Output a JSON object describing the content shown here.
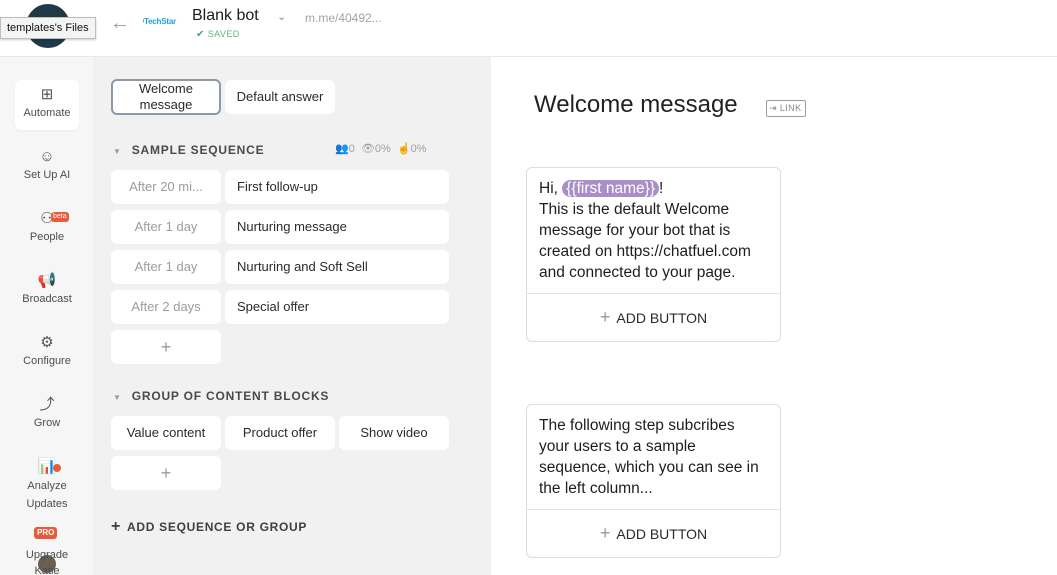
{
  "header": {
    "tooltip": "templates's Files",
    "techstar_logo": "TechStar",
    "bot_name": "Blank bot",
    "saved_status": "SAVED",
    "bot_url": "m.me/40492...",
    "back_icon": "arrow-left-icon"
  },
  "sidebar": {
    "items": [
      {
        "label": "Automate",
        "icon": "automate-icon"
      },
      {
        "label": "Set Up AI",
        "icon": "ai-icon"
      },
      {
        "label": "People",
        "icon": "people-icon",
        "badge": "beta"
      },
      {
        "label": "Broadcast",
        "icon": "megaphone-icon"
      },
      {
        "label": "Configure",
        "icon": "gear-icon"
      },
      {
        "label": "Grow",
        "icon": "grow-icon"
      },
      {
        "label": "Analyze",
        "icon": "chart-icon"
      },
      {
        "label": "Updates",
        "icon": "updates-icon"
      },
      {
        "label": "Upgrade",
        "icon": "upgrade-icon",
        "badge": "PRO"
      },
      {
        "label": "Katie",
        "icon": "avatar"
      }
    ]
  },
  "middle": {
    "top_tabs": [
      "Welcome message",
      "Default answer"
    ],
    "sequence": {
      "title": "SAMPLE SEQUENCE",
      "stats": {
        "users": "0",
        "views": "0%",
        "clicks": "0%"
      },
      "rows": [
        {
          "delay": "After 20 mi...",
          "name": "First follow-up"
        },
        {
          "delay": "After 1 day",
          "name": "Nurturing message"
        },
        {
          "delay": "After 1 day",
          "name": "Nurturing and Soft Sell"
        },
        {
          "delay": "After 2 days",
          "name": "Special offer"
        }
      ],
      "add": "+"
    },
    "group": {
      "title": "GROUP OF CONTENT BLOCKS",
      "blocks": [
        "Value content",
        "Product offer",
        "Show video"
      ],
      "add": "+"
    },
    "add_sequence_label": "ADD SEQUENCE OR GROUP"
  },
  "editor": {
    "title": "Welcome message",
    "link_label": "LINK",
    "cards": [
      {
        "greeting": "Hi, ",
        "attribute": "{{first name}}",
        "after_attr": "!",
        "body": "This is the default Welcome message for your bot that is created on https://chatfuel.com and connected to your page.",
        "button": "ADD BUTTON"
      },
      {
        "body": "The following step subcribes your users to a sample sequence, which you can see in the left column...",
        "button": "ADD BUTTON"
      }
    ]
  }
}
